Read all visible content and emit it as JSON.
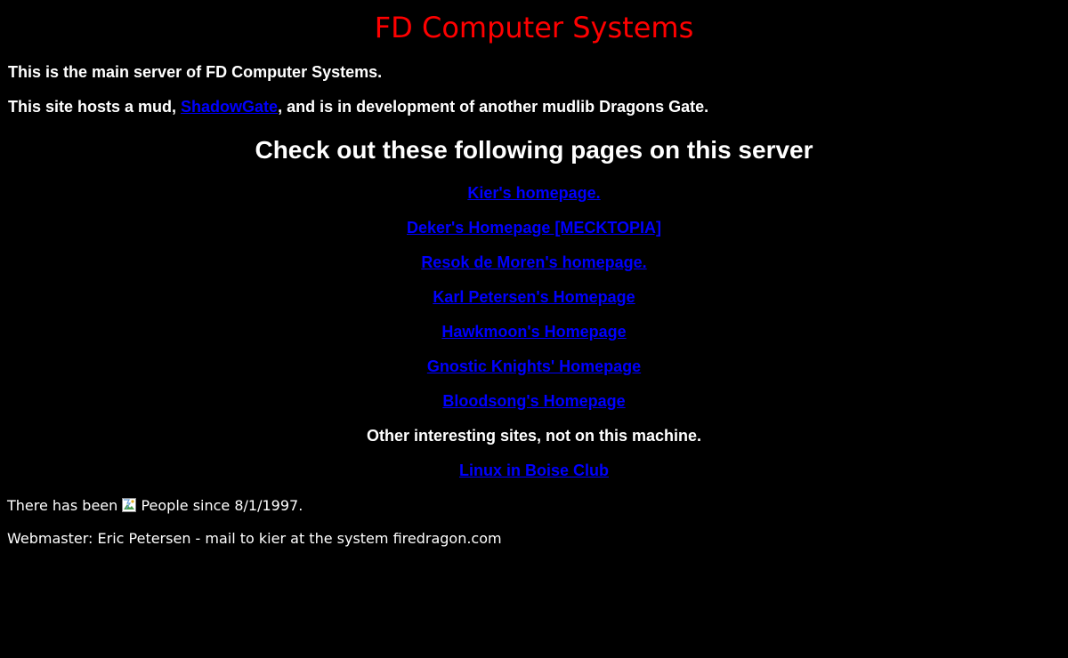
{
  "header": {
    "title": "FD Computer Systems"
  },
  "intro": {
    "line1": "This is the main server of FD Computer Systems.",
    "line2_before": "This site hosts a mud, ",
    "line2_link": "ShadowGate",
    "line2_after": ", and is in development of another mudlib Dragons Gate."
  },
  "links_section": {
    "heading": "Check out these following pages on this server",
    "links": [
      "Kier's homepage.",
      "Deker's Homepage [MECKTOPIA]",
      "Resok de Moren's homepage.",
      "Karl Petersen's Homepage",
      "Hawkmoon's Homepage",
      "Gnostic Knights' Homepage",
      "Bloodsong's Homepage"
    ]
  },
  "other_sites": {
    "heading": "Other interesting sites, not on this machine.",
    "links": [
      "Linux in Boise Club"
    ]
  },
  "footer": {
    "counter_before": "There has been",
    "counter_after": "People since 8/1/1997.",
    "counter_icon": "broken-image-icon",
    "webmaster": "Webmaster: Eric Petersen - mail to kier at the system firedragon.com"
  },
  "colors": {
    "background": "#000000",
    "text": "#ffffff",
    "title": "#ff0000",
    "link": "#0000ff"
  }
}
